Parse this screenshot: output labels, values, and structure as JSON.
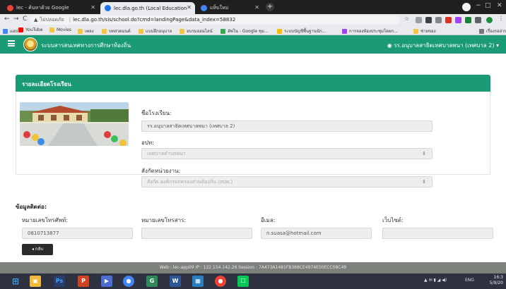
{
  "browser": {
    "tabs": [
      {
        "title": "lec - ค้นหาด้วย Google",
        "favicon_color": "#ea4335",
        "active": false
      },
      {
        "title": "lec.dla.go.th (Local Education",
        "favicon_color": "#1a73e8",
        "active": true
      },
      {
        "title": "แท็บใหม่",
        "favicon_color": "#4285f4",
        "active": false
      }
    ],
    "new_tab": "+",
    "window_controls": {
      "minimize": "−",
      "maximize": "□",
      "close": "✕"
    },
    "nav": {
      "back": "←",
      "forward": "→",
      "reload": "C"
    },
    "address": {
      "warning": "▲",
      "security_text": "ไม่ปลอดภัย",
      "url": "lec.dla.go.th/sis/school.do?cmd=landingPage&data_index=58832"
    },
    "bookmarks": [
      {
        "label": "แอป",
        "color": "#4285f4"
      },
      {
        "label": "YouTube",
        "color": "#ff0000"
      },
      {
        "label": "Movies",
        "color": "#f4c542"
      },
      {
        "label": "เพลง",
        "color": "#f4c542"
      },
      {
        "label": "บทสวดมนต์",
        "color": "#f4c542"
      },
      {
        "label": "แบบฝึกอนุบาล",
        "color": "#f4c542"
      },
      {
        "label": "อบรมออนไลน์",
        "color": "#f4c542"
      },
      {
        "label": "อัพโน - Google ชุม...",
        "color": "#34a853"
      },
      {
        "label": "ระบบบัญชีพื้นฐานนัก...",
        "color": "#fbbc05"
      },
      {
        "label": "การจองห้องประชุมโดยก...",
        "color": "#a142f4"
      },
      {
        "label": "ช่ายของ",
        "color": "#f4c542"
      },
      {
        "label": "เรื่องรออ่าน",
        "color": "#777777"
      }
    ]
  },
  "header": {
    "title": "ระบบสารสนเทศทางการศึกษาท้องถิ่น",
    "user": "รร.อนุบาลสาธิตเทศบาลพนา (เทศบาล 2)",
    "user_icon": "user-circle-icon",
    "caret": "▾"
  },
  "section": {
    "title": "รายละเอียดโรงเรียน",
    "school_name_label": "ชื่อโรงเรียน:",
    "school_name_value": "รร.อนุบาลสาธิตเทศบาลพนา (เทศบาล 2)",
    "apt_label": "อปท:",
    "apt_value": "เทศบาลตำบลพนา",
    "affiliation_label": "สังกัดหน่วยงาน:",
    "affiliation_value": "สังกัด องค์กรปกครองส่วนท้องถิ่น (สปท.)",
    "select_arrow": "⇕"
  },
  "contact": {
    "title": "ข้อมูลติดต่อ:",
    "phone_label": "หมายเลขโทรศัพท์:",
    "phone_value": "0810713877",
    "fax_label": "หมายเลขโทรสาร:",
    "fax_value": "",
    "email_label": "อีเมล:",
    "email_value": "n.suasa@hotmail.com",
    "website_label": "เว็บไซต์:",
    "website_value": ""
  },
  "back_button": "◂ กลับ",
  "footer": "Web : lec-app09   IP : 122.154.142.26   Session : 7A473A1481FB368CE4974E50ECC08C49",
  "taskbar": {
    "apps": [
      {
        "name": "start",
        "label": "⊞",
        "color": "#2d3140"
      },
      {
        "name": "file-explorer",
        "label": "▣",
        "color": "#f0b93a"
      },
      {
        "name": "photoshop",
        "label": "Ps",
        "color": "#2c3e6b"
      },
      {
        "name": "powerpoint",
        "label": "P",
        "color": "#d04423"
      },
      {
        "name": "media",
        "label": "▶",
        "color": "#4a6fd0"
      },
      {
        "name": "chrome",
        "label": "●",
        "color": "#4285f4"
      },
      {
        "name": "app-green",
        "label": "G",
        "color": "#2e8b57"
      },
      {
        "name": "word",
        "label": "W",
        "color": "#2b579a"
      },
      {
        "name": "photos",
        "label": "▦",
        "color": "#2a7fc1"
      },
      {
        "name": "chrome-2",
        "label": "●",
        "color": "#ea4335"
      },
      {
        "name": "line",
        "label": "☐",
        "color": "#06c755"
      }
    ],
    "tray_text": "ENG",
    "time": "16:3",
    "date": "5/9/20"
  }
}
